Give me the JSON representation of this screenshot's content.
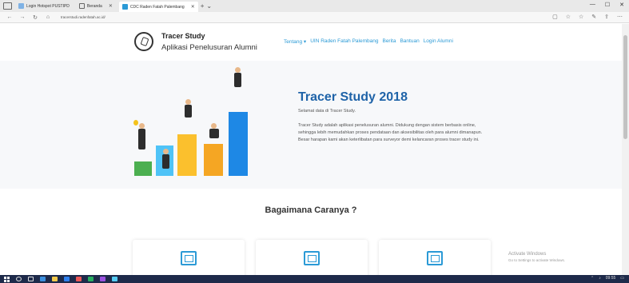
{
  "browser": {
    "tabs": [
      {
        "label": "Login Hotspot PUSTIPD"
      },
      {
        "label": "Beranda"
      },
      {
        "label": "CDC Raden Fatah Palembang"
      }
    ],
    "url": "tracerstudi.radenfatah.ac.id/"
  },
  "site": {
    "brand_title": "Tracer Study",
    "brand_subtitle": "Aplikasi Penelusuran Alumni",
    "nav": {
      "tentang": "Tentang ▾",
      "uin": "UIN Raden Fatah Palembang",
      "berita": "Berita",
      "bantuan": "Bantuan",
      "login": "Login Alumni"
    }
  },
  "hero": {
    "title": "Tracer Study 2018",
    "tagline": "Selamat data di Tracer Study.",
    "description": "Tracer Study adalah aplikasi penelusuran alumni. Didukung dengan sistem berbasis online, sehingga lebih memudahkan proses pendataan dan aksesibilitas oleh para alumni dimanapun. Besar harapan kami akan keterlibatan para surveyor demi kelancaran proses tracer study ini."
  },
  "section": {
    "title": "Bagaimana Caranya ?"
  },
  "watermark": {
    "line1": "Activate Windows",
    "line2": "Go to Settings to activate Windows."
  },
  "taskbar": {
    "time": "09:55"
  },
  "colors": {
    "accent": "#2b9ad6",
    "hero_title": "#1f63a8",
    "taskbar": "#1e2a4a"
  }
}
